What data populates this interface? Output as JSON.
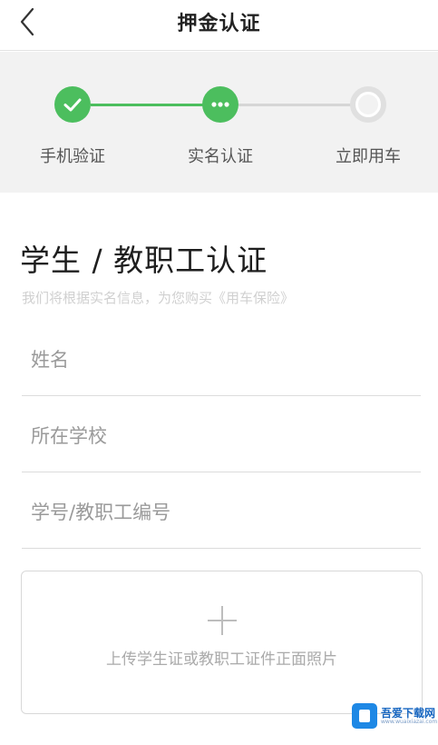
{
  "header": {
    "title": "押金认证",
    "back_icon": "back-chevron-icon"
  },
  "stepper": {
    "steps": [
      {
        "label": "手机验证",
        "status": "done",
        "icon": "check-icon"
      },
      {
        "label": "实名认证",
        "status": "current",
        "icon": "ellipsis-icon"
      },
      {
        "label": "立即用车",
        "status": "pending",
        "icon": "circle-icon"
      }
    ],
    "active_color": "#4cbe5e",
    "inactive_color": "#d6d6d6"
  },
  "form": {
    "heading": "学生 / 教职工认证",
    "subtitle": "我们将根据实名信息，为您购买《用车保险》",
    "fields": [
      {
        "placeholder": "姓名",
        "value": ""
      },
      {
        "placeholder": "所在学校",
        "value": ""
      },
      {
        "placeholder": "学号/教职工编号",
        "value": ""
      }
    ],
    "upload": {
      "icon": "plus-icon",
      "label": "上传学生证或教职工证件正面照片"
    }
  },
  "watermark": {
    "text": "吾爱下载网",
    "sub": "www.wuaixiazai.com"
  }
}
